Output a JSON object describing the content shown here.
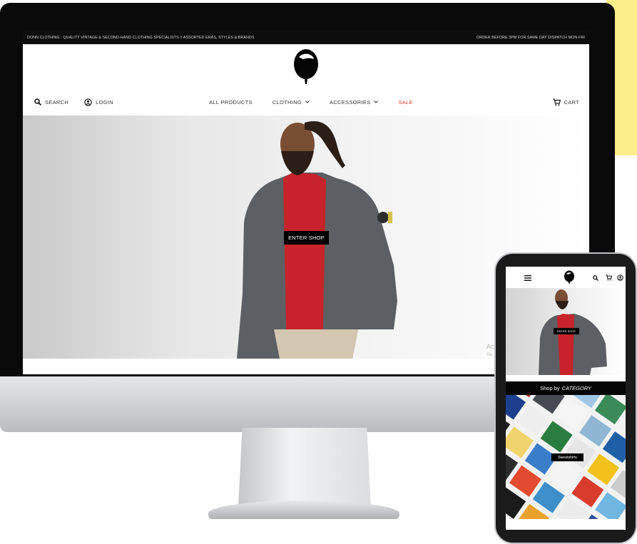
{
  "desktop": {
    "announcement": {
      "left": "DONN CLOTHING : QUALITY VINTAGE & SECOND-HAND CLOTHING SPECIALISTS // ASSORTED ERAS, STYLES & BRANDS",
      "right": "ORDER BEFORE 3PM FOR SAME DAY DISPATCH MON-FRI"
    },
    "header": {
      "search_label": "SEARCH",
      "login_label": "LOGIN",
      "cart_label": "CART"
    },
    "nav": {
      "all_products": "ALL PRODUCTS",
      "clothing": "CLOTHING",
      "accessories": "ACCESSORIES",
      "sale": "SALE"
    },
    "hero": {
      "cta_label": "ENTER SHOP"
    },
    "watermark": {
      "line1": "Ac",
      "line2": "Go"
    }
  },
  "mobile": {
    "hero_cta": "ENTER SHOP",
    "category_heading": {
      "prefix": "Shop by",
      "emphasis": "CATEGORY"
    },
    "category_label": "Sweatshirts"
  },
  "colors": {
    "sale": "#e0392b",
    "sticky_note": "#fbee8a",
    "bezel": "#0a0a0a",
    "announcement_bg": "#0d0d0d"
  },
  "icons": [
    "search-icon",
    "user-icon",
    "chevron-down-icon",
    "cart-icon",
    "menu-icon",
    "logo-icon"
  ]
}
